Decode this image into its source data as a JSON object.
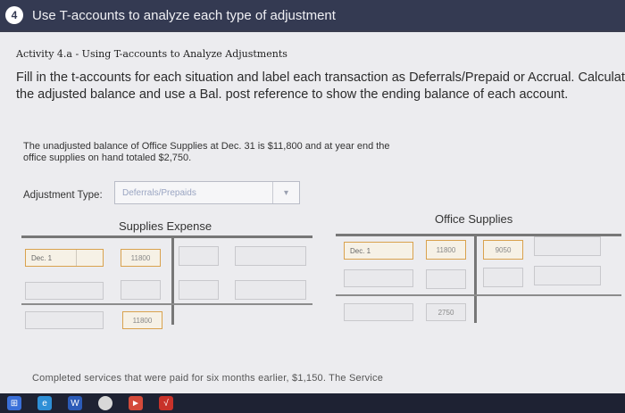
{
  "header": {
    "step": "4",
    "title": "Use T-accounts to analyze each type of adjustment"
  },
  "activity_title": "Activity 4.a - Using T-accounts to Analyze Adjustments",
  "instructions": "Fill in the t-accounts for each situation and label each transaction as Deferrals/Prepaid or Accrual. Calculate the adjusted balance and use a Bal. post reference to show the ending balance of each account.",
  "scenario": "The unadjusted balance of Office Supplies at Dec. 31 is $11,800 and at year end the office supplies on hand totaled $2,750.",
  "adjustment": {
    "label": "Adjustment Type:",
    "value": "Deferrals/Prepaids"
  },
  "supplies_expense": {
    "title": "Supplies Expense",
    "debit_date": "Dec. 1",
    "debit_amount": "11800",
    "balance_amount": "11800"
  },
  "office_supplies": {
    "title": "Office Supplies",
    "debit_date": "Dec. 1",
    "debit_amount": "11800",
    "credit_amount": "9050",
    "balance_amount": "2750"
  },
  "next_item": "Completed services that were paid for six months earlier, $1,150. The Service",
  "taskbar": {
    "icons": [
      "windows-icon",
      "edge-icon",
      "word-icon",
      "chrome-icon",
      "media-icon",
      "pdf-icon"
    ]
  }
}
